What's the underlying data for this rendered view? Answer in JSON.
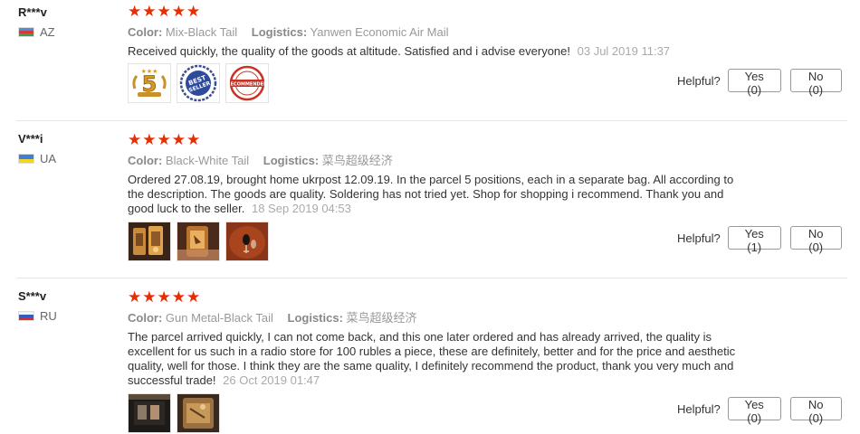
{
  "labels": {
    "color": "Color:",
    "logistics": "Logistics:",
    "helpful": "Helpful?"
  },
  "colors": {
    "star": "#e62e04",
    "date": "#aaaaaa",
    "attr_value": "#999999"
  },
  "reviews": [
    {
      "buyer": "R***v",
      "country": "AZ",
      "rating": 5,
      "color_value": "Mix-Black Tail",
      "logistics_value": "Yanwen Economic Air Mail",
      "text": "Received quickly, the quality of the goods at altitude. Satisfied and i advise everyone!",
      "date": "03 Jul 2019 11:37",
      "photos": [
        "gold-5-star-badge",
        "best-seller-seal",
        "recommended-stamp"
      ],
      "yes": "Yes (0)",
      "no": "No (0)"
    },
    {
      "buyer": "V***i",
      "country": "UA",
      "rating": 5,
      "color_value": "Black-White Tail",
      "logistics_value": "菜鸟超级经济",
      "text": "Ordered 27.08.19, brought home ukrpost 12.09.19. In the parcel 5 positions, each in a separate bag. All according to the description. The goods are quality. Soldering has not tried yet. Shop for shopping i recommend. Thank you and good luck to the seller.",
      "date": "18 Sep 2019 04:53",
      "photos": [
        "lures-package-photo",
        "lures-in-hand-photo",
        "lure-closeup-photo"
      ],
      "yes": "Yes (1)",
      "no": "No (0)"
    },
    {
      "buyer": "S***v",
      "country": "RU",
      "rating": 5,
      "color_value": "Gun Metal-Black Tail",
      "logistics_value": "菜鸟超级经济",
      "text": "The parcel arrived quickly, I can not come back, and this one later ordered and has already arrived, the quality is excellent for us such in a radio store for 100 rubles a piece, these are definitely, better and for the price and aesthetic quality, well for those. I think they are the same quality, I definitely recommend the product, thank you very much and successful trade!",
      "date": "26 Oct 2019 01:47",
      "photos": [
        "lures-dark-photo",
        "lures-bag-photo"
      ],
      "yes": "Yes (0)",
      "no": "No (0)"
    }
  ]
}
